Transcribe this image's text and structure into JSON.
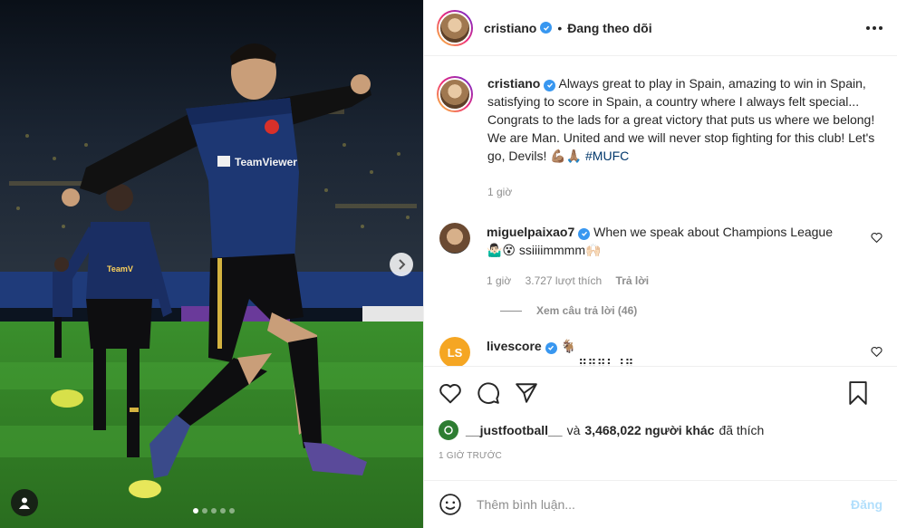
{
  "post": {
    "username": "cristiano",
    "follow_status": "Đang theo dõi",
    "caption": "Always great to play in Spain, amazing to win in Spain, satisfying to score in Spain, a country where I always felt special... Congrats to the lads for a great victory that puts us where we belong! We are Man. United and we will never stop fighting for this club! Let's go, Devils! 💪🏽🙏🏽",
    "hashtag": "#MUFC",
    "caption_time": "1 giờ"
  },
  "media": {
    "jersey_text_1": "TeamViewer",
    "jersey_text_2": "TeamV",
    "dots_count": 5,
    "active_dot": 0
  },
  "comments": [
    {
      "username": "miguelpaixao7",
      "text": "When we speak about Champions League 🤷🏻‍♂️😵 ssiiiimmmm🙌🏻",
      "time": "1 giờ",
      "likes": "3.727 lượt thích",
      "reply": "Trả lời",
      "view_replies": "Xem câu trả lời (46)"
    },
    {
      "username": "livescore",
      "avatar_text": "LS",
      "text": "🐐",
      "text2": "..........................⣿⣿⣿⡇⢸⣿"
    }
  ],
  "likes": {
    "first_user": "__justfootball__",
    "connector": "và",
    "others": "3,468,022 người khác",
    "suffix": "đã thích"
  },
  "time_ago": "1 GIỜ TRƯỚC",
  "comment_box": {
    "placeholder": "Thêm bình luận...",
    "post_label": "Đăng"
  },
  "colors": {
    "verified": "#3897f0",
    "hashtag": "#00376b",
    "post_disabled": "#b2dffc"
  }
}
